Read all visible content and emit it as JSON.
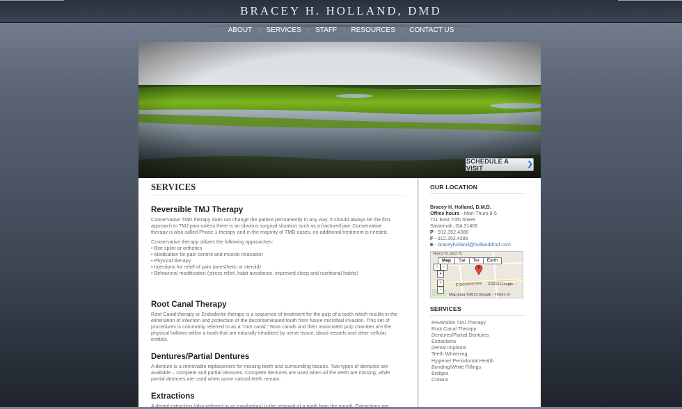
{
  "site": {
    "title": "BRACEY H. HOLLAND, DMD"
  },
  "nav": {
    "items": [
      "ABOUT",
      "SERVICES",
      "STAFF",
      "RESOURCES",
      "CONTACT US"
    ]
  },
  "hero": {
    "button_label": "SCHEDULE A VISIT",
    "button_icon": "chevron-right-icon"
  },
  "main": {
    "title": "SERVICES",
    "sections": [
      {
        "heading": "Reversible TMJ Therapy",
        "paragraphs": [
          "Conservative TMD therapy does not change the patient permanently in any way. It should always be the first approach to TMJ pain unless there is an obvious surgical situation such as a fractured jaw. Conservative therapy is also called Phase 1 therapy and in the majority of TMD cases, no additional treatment is needed.",
          "Conservative therapy utilizes the following approaches:\n• Bite splint or orthotics\n• Medication for pain control and muscle relaxation\n• Physical therapy\n• Injections for relief of pain (anesthetic or steroid)\n• Behavioral modification (stress relief, habit avoidance, improved sleep and nutritional habits)"
        ]
      },
      {
        "heading": "Root Canal Therapy",
        "paragraphs": [
          "Root Canal therapy or Endodontic therapy is a sequence of treatment for the pulp of a tooth which results in the elimination of infection and protection of the decontaminated tooth from future microbial invasion. This set of procedures is commonly referred to as a “root canal.” Root canals and their associated pulp chamber are the physical hollows within a tooth that are naturally inhabited by nerve tissue, blood vessels and other cellular entities."
        ]
      },
      {
        "heading": "Dentures/Partial Dentures",
        "paragraphs": [
          "A denture is a removable replacement for missing teeth and surrounding tissues. Two types of dentures are available – complete and partial dentures. Complete dentures are used when all the teeth are missing, while partial dentures are used when some natural teeth remain."
        ]
      },
      {
        "heading": "Extractions",
        "paragraphs": [
          "A dental extraction (also referred to as exodontias) is the removal of a tooth from the mouth. Extractions are"
        ]
      }
    ]
  },
  "sidebar": {
    "location_heading": "OUR LOCATION",
    "contact": {
      "name": "Bracey H. Holland, D.M.D.",
      "hours_label": "Office hours",
      "hours": " - Mon-Thurs 8-5",
      "street": "711 East 70th Street",
      "city": "Savannah, GA 31405",
      "phone_label": "P",
      "phone": " - 912.352.4386",
      "fax_label": "F",
      "fax": " - 912.352.4386",
      "email_label": "E",
      "email": "braceyholland@hollanddmd.com"
    },
    "map": {
      "tabs": [
        "Map",
        "Sat",
        "Ter",
        "Earth"
      ],
      "street_label": "Nancy N. and JC",
      "copyright": "©2013 Google -",
      "footer": "Map data ©2013 Google - Terms of",
      "road_label": "E Derenne Ave"
    },
    "services_heading": "SERVICES",
    "services": [
      "Reversible TMJ Therapy",
      "Root Canal Therapy",
      "Dentures/Partial Dentures",
      "Extractions",
      "Dental Implants",
      "Teeth Whitening",
      "Hygiene/ Periodontal Health",
      "Bonding/White Fillings",
      "Bridges",
      "Crowns"
    ]
  }
}
